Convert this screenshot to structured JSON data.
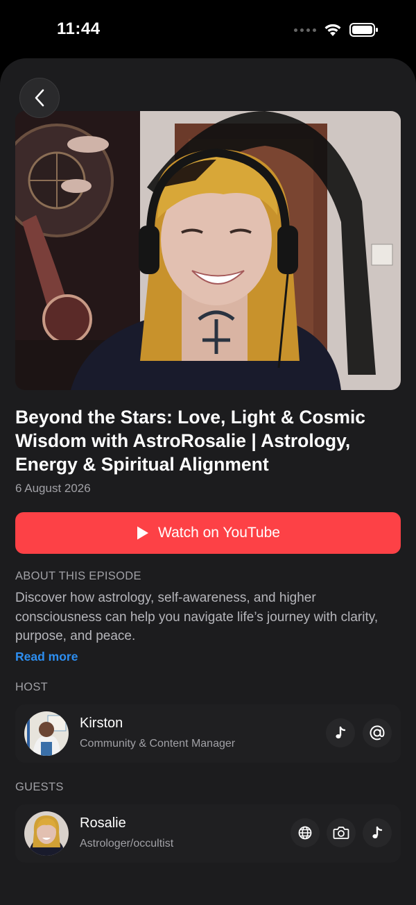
{
  "status_bar": {
    "time": "11:44"
  },
  "episode": {
    "title": "Beyond the Stars: Love, Light & Cosmic Wisdom with AstroRosalie | Astrology, Energy & Spiritual Alignment",
    "date": "6 August 2026",
    "watch_label": "Watch on YouTube",
    "about_heading": "ABOUT THIS EPISODE",
    "about_text": "Discover how astrology, self-awareness, and higher consciousness can help you navigate life’s journey with clarity, purpose, and peace.",
    "read_more": "Read more"
  },
  "host": {
    "heading": "HOST",
    "name": "Kirston",
    "role": "Community & Content Manager",
    "links": [
      "music-note-icon",
      "at-sign-icon"
    ]
  },
  "guests": {
    "heading": "GUESTS",
    "items": [
      {
        "name": "Rosalie",
        "role": "Astrologer/occultist",
        "links": [
          "globe-icon",
          "camera-icon",
          "music-note-icon"
        ]
      }
    ]
  },
  "colors": {
    "background": "#1c1c1e",
    "accent_red": "#fd4146",
    "link_blue": "#2d8ef0",
    "secondary_text": "#a1a1a6"
  }
}
